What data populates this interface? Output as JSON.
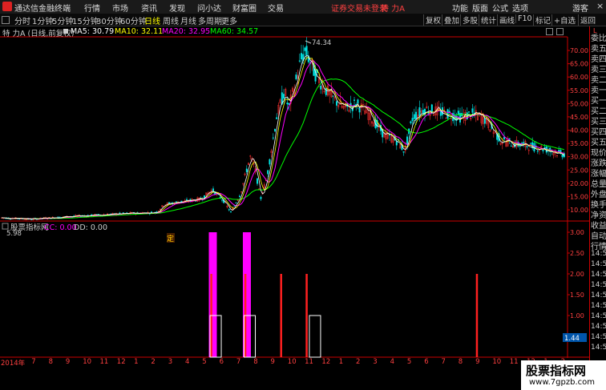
{
  "titlebar": {
    "app_title": "通达信金融终端",
    "menus": [
      "行情",
      "市场",
      "资讯",
      "发现",
      "问小达",
      "财富圈",
      "交易"
    ],
    "notice": "证券交易未登录",
    "stock_name": "特 力A",
    "right_menus": [
      "功能",
      "版面",
      "公式",
      "选项"
    ],
    "guest": "游客"
  },
  "toolbar": {
    "timeframes": [
      "分时",
      "1分钟",
      "5分钟",
      "15分钟",
      "30分钟",
      "60分钟",
      "日线",
      "周线",
      "月线",
      "多周期",
      "更多"
    ],
    "active_timeframe": "日线",
    "buttons": [
      "复权",
      "叠加",
      "多股",
      "统计",
      "画线",
      "F10",
      "标记",
      "+自选",
      "返回"
    ]
  },
  "info_bar": {
    "stock_label": "特 力A (日线,前复权)",
    "ma5": "MA5: 30.79",
    "ma10": "MA10: 32.11",
    "ma20": "MA20: 32.95",
    "ma60": "MA60: 34.57",
    "colors": {
      "ma5": "#ffffff",
      "ma10": "#ffff00",
      "ma20": "#ff00ff",
      "ma60": "#00ff00"
    }
  },
  "price_chart": {
    "high_label": "74.34",
    "low_label": "5.98",
    "marker": "定",
    "y_ticks": [
      "70.00",
      "65.00",
      "60.00",
      "55.00",
      "50.00",
      "45.00",
      "40.00",
      "35.00",
      "30.00",
      "25.00",
      "20.00",
      "15.00",
      "10.00"
    ]
  },
  "indicator": {
    "name": "股票指标网",
    "cc": "CC: 0.00",
    "dd": "DD: 0.00",
    "y_ticks": [
      "3.00",
      "2.50",
      "2.00",
      "1.50",
      "1.00",
      "0.50"
    ],
    "value_box": "1.44"
  },
  "chart_data": {
    "type": "bar",
    "title": "",
    "series": [
      {
        "name": "CC",
        "color": "#ff00ff",
        "points": [
          {
            "x": 0.375,
            "value": 3
          },
          {
            "x": 0.435,
            "value": 3
          }
        ]
      },
      {
        "name": "DD",
        "color": "#ff2020",
        "points": [
          {
            "x": 0.372,
            "value": 2
          },
          {
            "x": 0.432,
            "value": 2
          },
          {
            "x": 0.495,
            "value": 2
          },
          {
            "x": 0.54,
            "value": 2
          },
          {
            "x": 0.84,
            "value": 2
          }
        ]
      },
      {
        "name": "BOX",
        "color": "#ffffff",
        "points": [
          {
            "x": 0.38,
            "value": 1
          },
          {
            "x": 0.44,
            "value": 1
          },
          {
            "x": 0.555,
            "value": 1
          }
        ]
      }
    ],
    "ylim": [
      0,
      3.2
    ],
    "grid": false
  },
  "right_panel": {
    "items": [
      "委比",
      "卖五",
      "卖四",
      "卖三",
      "卖二",
      "卖一",
      "买一",
      "买二",
      "买三",
      "买四",
      "买五",
      "现价",
      "涨跌",
      "涨幅",
      "总量",
      "外盘",
      "换手",
      "净资",
      "收益",
      "自动",
      "行情",
      "14:55",
      "14:55",
      "14:56",
      "14:56",
      "14:56",
      "14:56",
      "14:56",
      "14:56",
      "14:56",
      "14:56"
    ]
  },
  "x_axis": {
    "labels": [
      "2014年",
      "7",
      "8",
      "9",
      "10",
      "11",
      "12",
      "1",
      "2",
      "3",
      "4",
      "5",
      "6",
      "7",
      "8",
      "9",
      "10",
      "11",
      "12",
      "1",
      "2",
      "3",
      "4",
      "5",
      "6",
      "7",
      "8",
      "9",
      "10",
      "11",
      "12",
      "1",
      "2"
    ]
  },
  "watermark": {
    "title": "股票指标网",
    "url": "www.7gpzb.com"
  }
}
